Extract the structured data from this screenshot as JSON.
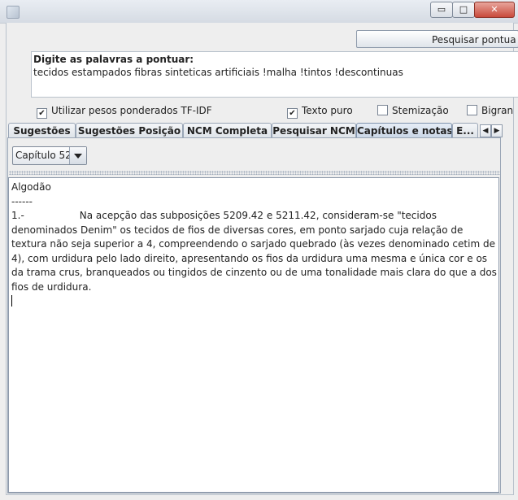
{
  "window": {
    "minimize_glyph": "▭",
    "maximize_glyph": "□",
    "close_glyph": "✕"
  },
  "toolbar": {
    "search_button_label": "Pesquisar pontua"
  },
  "query": {
    "label": "Digite as palavras a pontuar:",
    "value": "tecidos estampados fibras sinteticas artificiais !malha !tintos !descontinuas"
  },
  "options": [
    {
      "label": "Utilizar pesos ponderados TF-IDF",
      "checked": true
    },
    {
      "label": "Texto puro",
      "checked": true
    },
    {
      "label": "Stemização",
      "checked": false
    },
    {
      "label": "Bigran",
      "checked": false
    }
  ],
  "tabs": [
    {
      "label": "Sugestões",
      "active": false
    },
    {
      "label": "Sugestões Posição",
      "active": false
    },
    {
      "label": "NCM Completa",
      "active": false
    },
    {
      "label": "Pesquisar NCM",
      "active": false
    },
    {
      "label": "Capítulos e notas",
      "active": true
    },
    {
      "label": "E...",
      "active": false
    }
  ],
  "tab_scroll": {
    "left": "◀",
    "right": "▶"
  },
  "chapter_select": {
    "value": "Capítulo 52"
  },
  "content": {
    "line1": "Algodão",
    "line2": "------",
    "line3_num": "1.-",
    "paragraph_first": "Na acepção das subposições 5209.42 e 5211.42, consideram-se \"tecidos denominados",
    "paragraph_rest": "Denim\" os tecidos de fios de diversas cores, em ponto sarjado cuja relação de textura não seja superior a 4, compreendendo o sarjado quebrado (às vezes denominado cetim de 4), com urdidura pelo lado direito, apresentando os fios da urdidura uma mesma e única cor e os da trama crus, branqueados ou tingidos de cinzento ou de uma tonalidade mais clara do que a dos fios de urdidura."
  }
}
